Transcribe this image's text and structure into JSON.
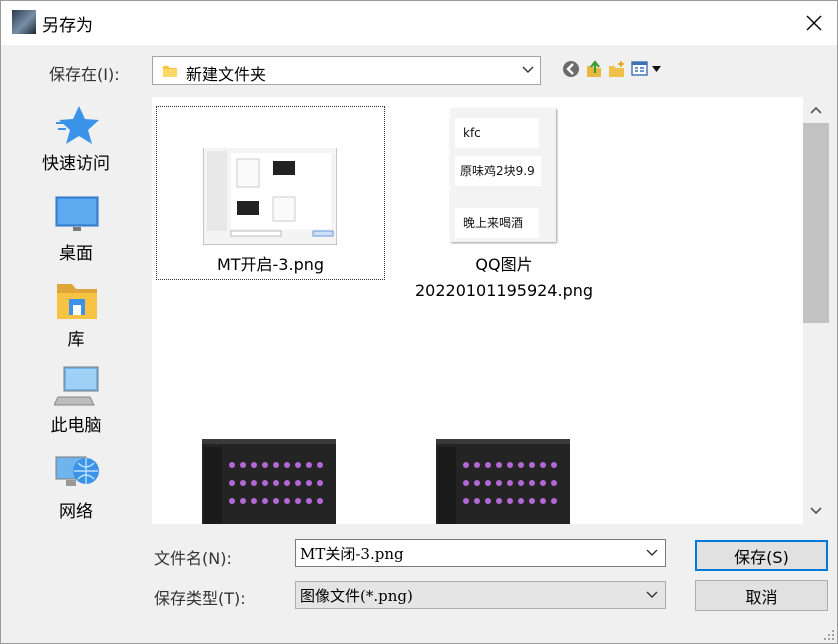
{
  "window": {
    "title": "另存为"
  },
  "location": {
    "label": "保存在(I):",
    "folder": "新建文件夹"
  },
  "places": [
    {
      "label": "快速访问",
      "icon": "star-icon"
    },
    {
      "label": "桌面",
      "icon": "desktop-icon"
    },
    {
      "label": "库",
      "icon": "library-icon"
    },
    {
      "label": "此电脑",
      "icon": "computer-icon"
    },
    {
      "label": "网络",
      "icon": "network-icon"
    }
  ],
  "files": [
    {
      "name": "MT开启-3.png",
      "selected": true
    },
    {
      "name_line1": "QQ图片",
      "name_line2": "20220101195924.png",
      "thumb_cards": [
        "kfc",
        "原味鸡2块9.9",
        "晚上来喝酒"
      ]
    },
    {
      "name": ""
    },
    {
      "name": ""
    }
  ],
  "filename": {
    "label": "文件名(N):",
    "value": "MT关闭-3.png"
  },
  "filetype": {
    "label": "保存类型(T):",
    "value": "图像文件(*.png)"
  },
  "buttons": {
    "save": "保存(S)",
    "cancel": "取消"
  },
  "colors": {
    "accent": "#0078d7",
    "folder": "#f6c343"
  }
}
